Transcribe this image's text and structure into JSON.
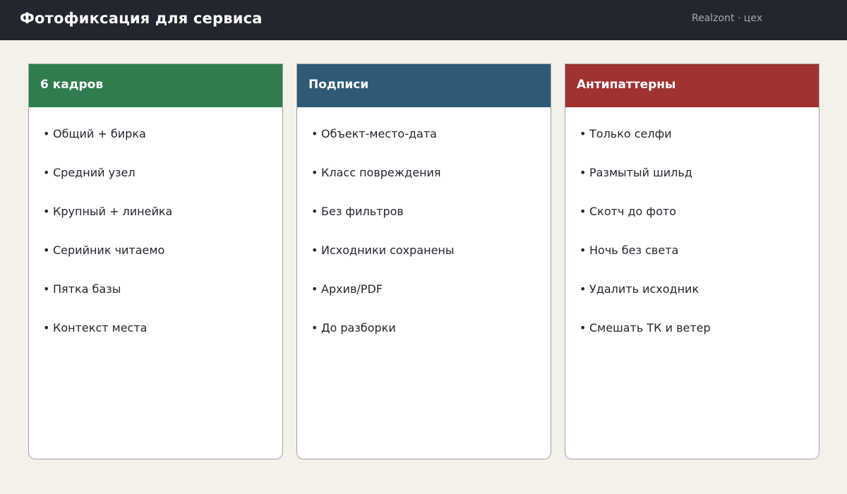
{
  "header": {
    "title": "Фотофиксация для сервиса",
    "brand": "Realzont · цех"
  },
  "colors": {
    "topbar": "#22262e",
    "background": "#f4f1ea",
    "card_green": "#2f7d4f",
    "card_blue": "#2e5a78",
    "card_red": "#a03232"
  },
  "cards": [
    {
      "title": "6 кадров",
      "items": [
        "Общий + бирка",
        "Средний узел",
        "Крупный + линейка",
        "Серийник читаемо",
        "Пятка базы",
        "Контекст места"
      ]
    },
    {
      "title": "Подписи",
      "items": [
        "Объект-место-дата",
        "Класс повреждения",
        "Без фильтров",
        "Исходники сохранены",
        "Архив/PDF",
        "До разборки"
      ]
    },
    {
      "title": "Антипаттерны",
      "items": [
        "Только селфи",
        "Размытый шильд",
        "Скотч до фото",
        "Ночь без света",
        "Удалить исходник",
        "Смешать ТК и ветер"
      ]
    }
  ]
}
